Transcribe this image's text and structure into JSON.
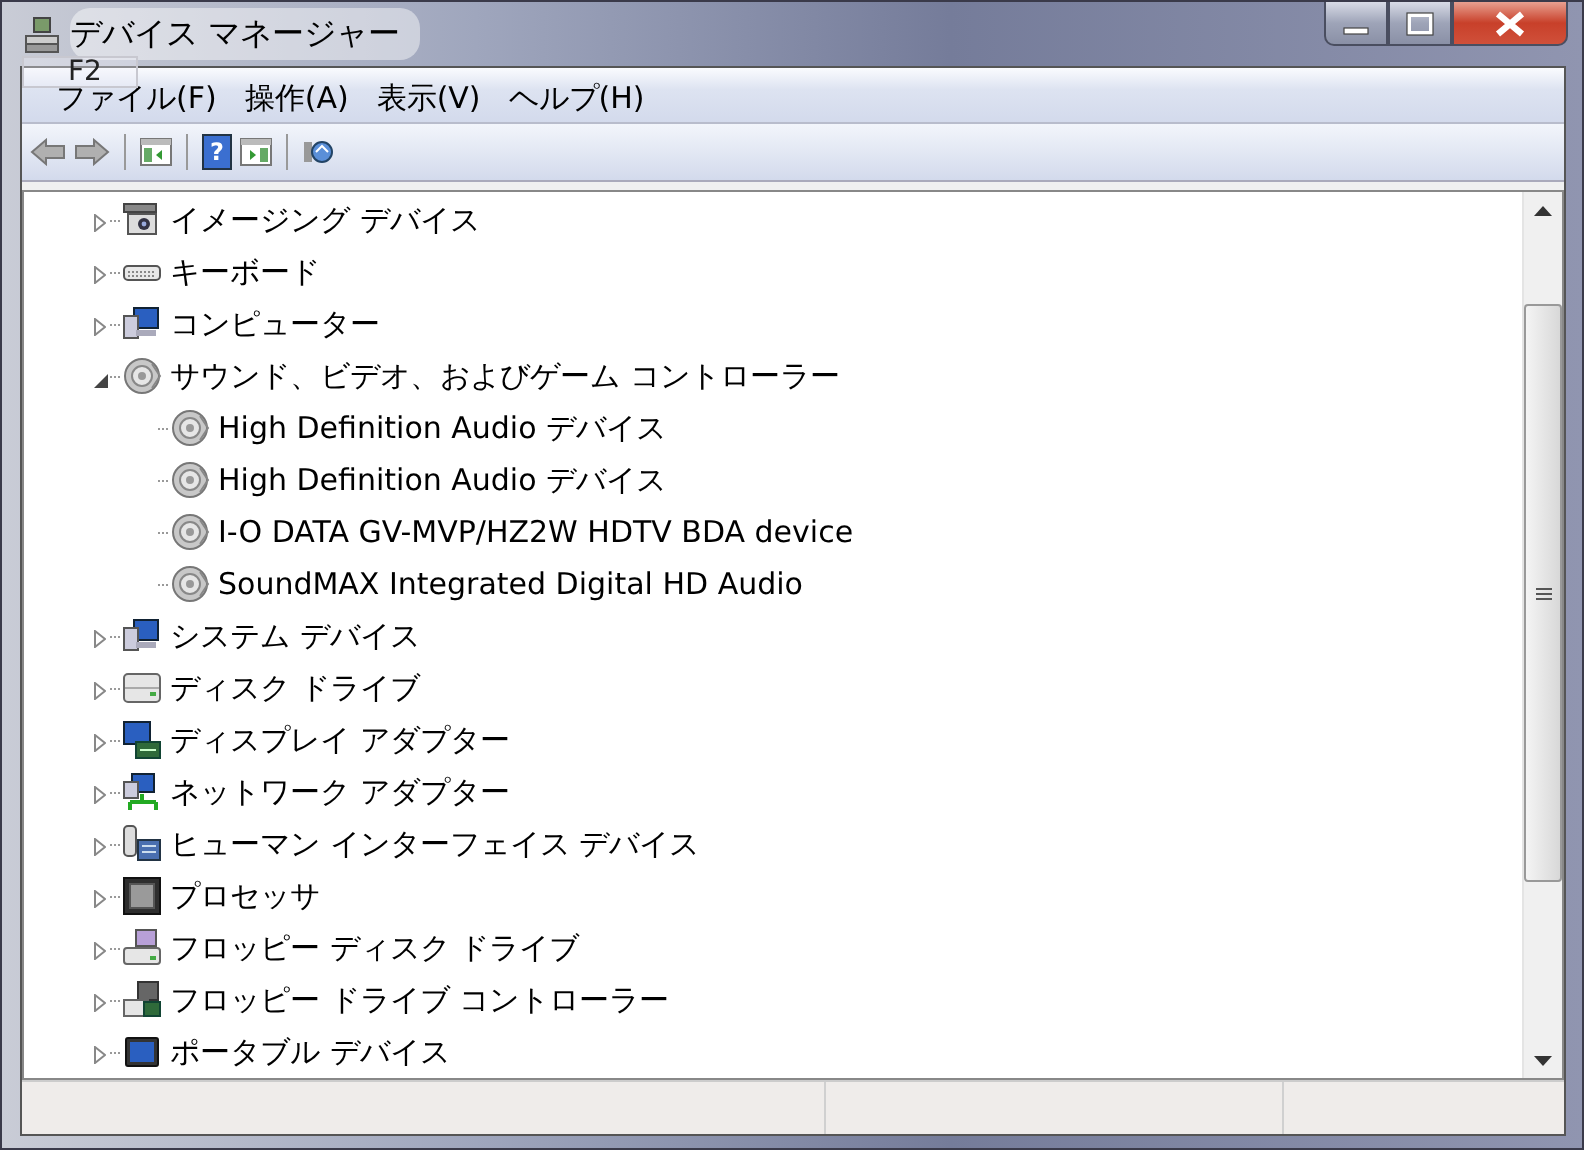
{
  "window": {
    "title": "デバイス マネージャー"
  },
  "tooltip": {
    "text": "F2"
  },
  "menu": [
    "ファイル(F)",
    "操作(A)",
    "表示(V)",
    "ヘルプ(H)"
  ],
  "toolbar": [
    {
      "kind": "back"
    },
    {
      "kind": "forward"
    },
    {
      "kind": "separator"
    },
    {
      "kind": "console-tree"
    },
    {
      "kind": "separator"
    },
    {
      "kind": "help",
      "label": "?"
    },
    {
      "kind": "action-pane"
    },
    {
      "kind": "separator"
    },
    {
      "kind": "scan"
    }
  ],
  "tree": [
    {
      "label": "イメージング デバイス",
      "kind": "camera",
      "expanded": false
    },
    {
      "label": "キーボード",
      "kind": "keyboard",
      "expanded": false
    },
    {
      "label": "コンピューター",
      "kind": "computer",
      "expanded": false
    },
    {
      "label": "サウンド、ビデオ、およびゲーム コントローラー",
      "kind": "speaker",
      "expanded": true,
      "children": [
        {
          "label": "High Definition Audio デバイス",
          "kind": "speaker"
        },
        {
          "label": "High Definition Audio デバイス",
          "kind": "speaker"
        },
        {
          "label": "I-O DATA GV-MVP/HZ2W HDTV BDA device",
          "kind": "speaker"
        },
        {
          "label": "SoundMAX Integrated Digital HD Audio",
          "kind": "speaker"
        }
      ]
    },
    {
      "label": "システム デバイス",
      "kind": "computer",
      "expanded": false
    },
    {
      "label": "ディスク ドライブ",
      "kind": "disk",
      "expanded": false
    },
    {
      "label": "ディスプレイ アダプター",
      "kind": "display",
      "expanded": false
    },
    {
      "label": "ネットワーク アダプター",
      "kind": "network",
      "expanded": false
    },
    {
      "label": "ヒューマン インターフェイス デバイス",
      "kind": "hid",
      "expanded": false
    },
    {
      "label": "プロセッサ",
      "kind": "cpu",
      "expanded": false
    },
    {
      "label": "フロッピー ディスク ドライブ",
      "kind": "floppy",
      "expanded": false
    },
    {
      "label": "フロッピー ドライブ コントローラー",
      "kind": "floppy-controller",
      "expanded": false
    },
    {
      "label": "ポータブル デバイス",
      "kind": "portable",
      "expanded": false
    }
  ]
}
